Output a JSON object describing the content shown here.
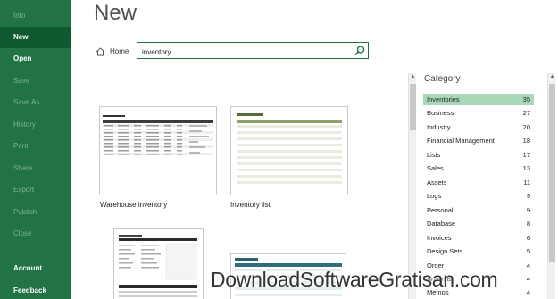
{
  "sidebar": {
    "items": [
      {
        "label": "Info",
        "state": "dim"
      },
      {
        "label": "New",
        "state": "active"
      },
      {
        "label": "Open",
        "state": "bold"
      },
      {
        "label": "Save",
        "state": "dim"
      },
      {
        "label": "Save As",
        "state": "dim"
      },
      {
        "label": "History",
        "state": "dim"
      },
      {
        "label": "Print",
        "state": "dim"
      },
      {
        "label": "Share",
        "state": "dim"
      },
      {
        "label": "Export",
        "state": "dim"
      },
      {
        "label": "Publish",
        "state": "dim"
      },
      {
        "label": "Close",
        "state": "dim"
      }
    ],
    "bottom": [
      {
        "label": "Account"
      },
      {
        "label": "Feedback"
      }
    ],
    "color": "#217346"
  },
  "main": {
    "title": "New",
    "home_label": "Home",
    "search_value": "inventory"
  },
  "templates": [
    {
      "label": "Warehouse inventory"
    },
    {
      "label": "Inventory list"
    },
    {
      "label": ""
    },
    {
      "label": ""
    }
  ],
  "category": {
    "title": "Category",
    "items": [
      {
        "name": "Inventories",
        "count": "35"
      },
      {
        "name": "Business",
        "count": "27"
      },
      {
        "name": "Industry",
        "count": "20"
      },
      {
        "name": "Financial Management",
        "count": "18"
      },
      {
        "name": "Lists",
        "count": "17"
      },
      {
        "name": "Sales",
        "count": "13"
      },
      {
        "name": "Assets",
        "count": "11"
      },
      {
        "name": "Logs",
        "count": "9"
      },
      {
        "name": "Personal",
        "count": "9"
      },
      {
        "name": "Database",
        "count": "8"
      },
      {
        "name": "Invoices",
        "count": "6"
      },
      {
        "name": "Design Sets",
        "count": "5"
      },
      {
        "name": "Order",
        "count": "4"
      },
      {
        "name": "Analysis",
        "count": "4"
      },
      {
        "name": "Memos",
        "count": "4"
      }
    ],
    "selected_color": "#a9d8b8"
  },
  "watermark": "DownloadSoftwareGratisan.com"
}
